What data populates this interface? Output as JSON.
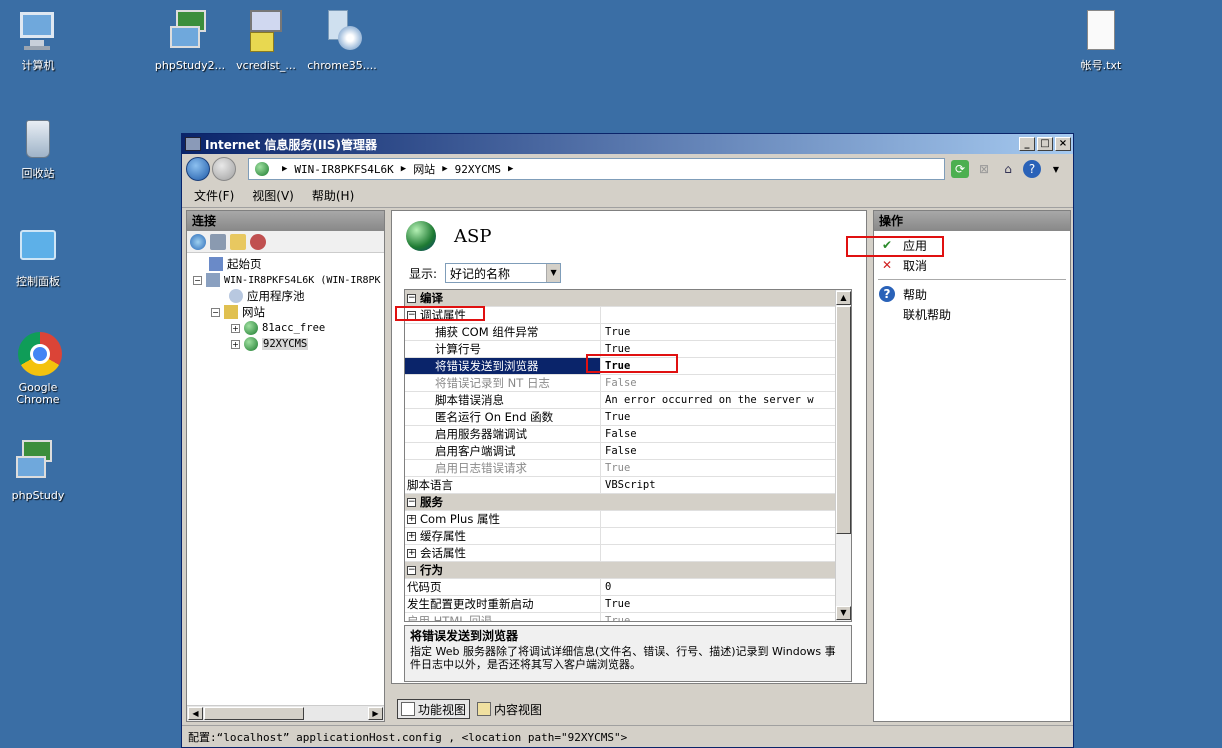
{
  "desktop": {
    "icons": [
      {
        "label": "计算机"
      },
      {
        "label": "回收站"
      },
      {
        "label": "控制面板"
      },
      {
        "label": "Google Chrome"
      },
      {
        "label": "phpStudy"
      },
      {
        "label": "phpStudy2..."
      },
      {
        "label": "vcredist_..."
      },
      {
        "label": "chrome35...."
      },
      {
        "label": "帐号.txt"
      }
    ]
  },
  "window": {
    "title": "Internet 信息服务(IIS)管理器",
    "controls": {
      "minimize": "_",
      "maximize": "□",
      "close": "×"
    }
  },
  "address": {
    "segments": [
      "WIN-IR8PKFS4L6K",
      "网站",
      "92XYCMS"
    ],
    "separator": "▶"
  },
  "menu": [
    "文件(F)",
    "视图(V)",
    "帮助(H)"
  ],
  "connections": {
    "title": "连接",
    "tree": [
      {
        "label": "起始页"
      },
      {
        "label": "WIN-IR8PKFS4L6K (WIN-IR8PK"
      },
      {
        "label": "应用程序池"
      },
      {
        "label": "网站"
      },
      {
        "label": "81acc_free"
      },
      {
        "label": "92XYCMS"
      }
    ]
  },
  "center": {
    "title": "ASP",
    "display_label": "显示:",
    "display_value": "好记的名称",
    "grid": [
      {
        "kind": "cat",
        "name": "编译",
        "toggle": "⊟"
      },
      {
        "kind": "sub",
        "name": "调试属性",
        "toggle": "⊟",
        "value": ""
      },
      {
        "kind": "row",
        "name": "捕获 COM 组件异常",
        "value": "True"
      },
      {
        "kind": "row",
        "name": "计算行号",
        "value": "True"
      },
      {
        "kind": "sel",
        "name": "将错误发送到浏览器",
        "value": "True"
      },
      {
        "kind": "dis",
        "name": "将错误记录到 NT 日志",
        "value": "False"
      },
      {
        "kind": "row",
        "name": "脚本错误消息",
        "value": "An error occurred on the server w"
      },
      {
        "kind": "row",
        "name": "匿名运行 On End 函数",
        "value": "True"
      },
      {
        "kind": "row",
        "name": "启用服务器端调试",
        "value": "False"
      },
      {
        "kind": "row",
        "name": "启用客户端调试",
        "value": "False"
      },
      {
        "kind": "dis",
        "name": "启用日志错误请求",
        "value": "True"
      },
      {
        "kind": "top",
        "name": "脚本语言",
        "value": "VBScript"
      },
      {
        "kind": "cat",
        "name": "服务",
        "toggle": "⊟"
      },
      {
        "kind": "sub",
        "name": "Com Plus 属性",
        "toggle": "⊞",
        "value": ""
      },
      {
        "kind": "sub",
        "name": "缓存属性",
        "toggle": "⊞",
        "value": ""
      },
      {
        "kind": "sub",
        "name": "会话属性",
        "toggle": "⊞",
        "value": ""
      },
      {
        "kind": "cat",
        "name": "行为",
        "toggle": "⊟"
      },
      {
        "kind": "top",
        "name": "代码页",
        "value": "0"
      },
      {
        "kind": "top",
        "name": "发生配置更改时重新启动",
        "value": "True"
      },
      {
        "kind": "dis2",
        "name": "启用 HTML 回退",
        "value": "True"
      }
    ],
    "desc_title": "将错误发送到浏览器",
    "desc_text": "指定 Web 服务器除了将调试详细信息(文件名、错误、行号、描述)记录到 Windows 事件日志中以外，是否还将其写入客户端浏览器。",
    "tabs": [
      "功能视图",
      "内容视图"
    ]
  },
  "actions": {
    "title": "操作",
    "items": [
      "应用",
      "取消",
      "帮助",
      "联机帮助"
    ]
  },
  "status": "配置:“localhost” applicationHost.config , <location path=\"92XYCMS\">"
}
